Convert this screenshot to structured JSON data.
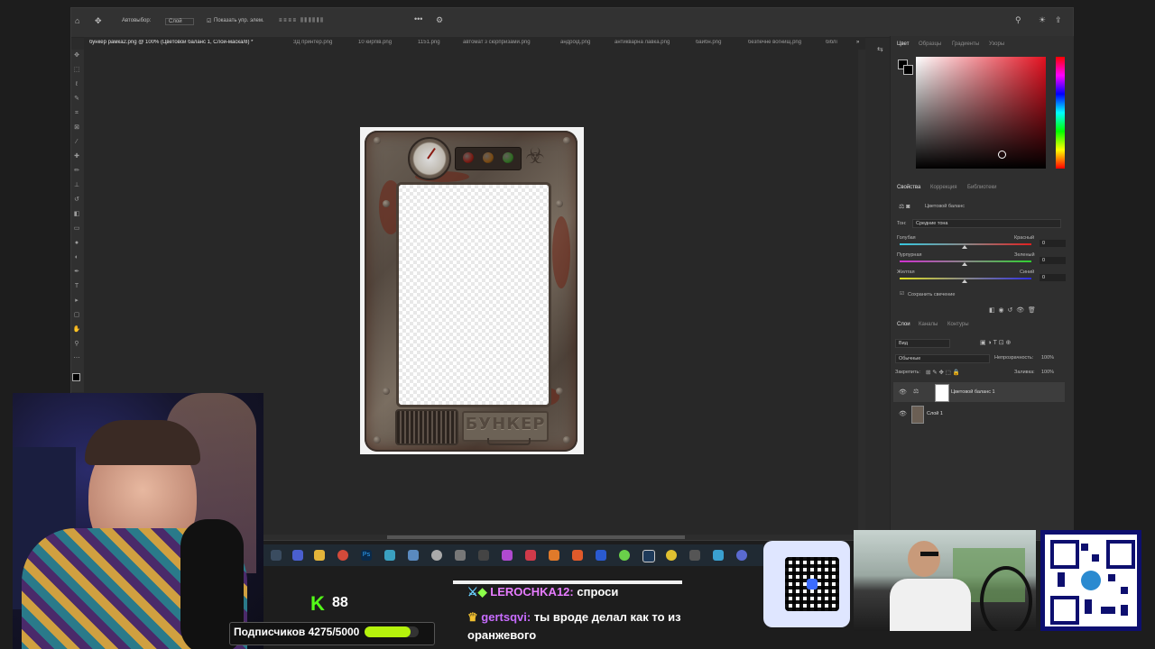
{
  "photoshop": {
    "options_bar": {
      "autoselect_label": "Автовыбор:",
      "autoselect_value": "Слой",
      "show_controls_label": "Показать упр. элем."
    },
    "tabs": [
      {
        "label": "бункер рамка2.png @ 100% (Цветовой баланс 1, Слой-маска/8) *",
        "active": true
      },
      {
        "label": "3Д принтер.png"
      },
      {
        "label": "10 кирпів.png"
      },
      {
        "label": "1151.png"
      },
      {
        "label": "автомат з сюрпризами.png"
      },
      {
        "label": "андрóід.png"
      },
      {
        "label": "антикварна лавка.png"
      },
      {
        "label": "байбн.png"
      },
      {
        "label": "безпечне вогнищ.png"
      },
      {
        "label": "біблі"
      }
    ],
    "document": {
      "plate_text": "БУНКЕР",
      "lamp_colors": [
        "#7a1a12",
        "#7a4a12",
        "#2f6b22"
      ]
    },
    "color_panel": {
      "tabs": [
        "Цвет",
        "Образцы",
        "Градиенты",
        "Узоры"
      ],
      "hue_color": "#e31120"
    },
    "properties_panel": {
      "tabs": [
        "Свойства",
        "Коррекция",
        "Библиотеки"
      ],
      "adjustment_name": "Цветовой баланс",
      "tone_label": "Тон:",
      "tone_value": "Средние тона",
      "sliders": [
        {
          "left": "Голубая",
          "right": "Красный",
          "value": "0",
          "colors": [
            "#36c8e0",
            "#e02020"
          ]
        },
        {
          "left": "Пурпурная",
          "right": "Зеленый",
          "value": "0",
          "colors": [
            "#d030d0",
            "#30d030"
          ]
        },
        {
          "left": "Желтая",
          "right": "Синий",
          "value": "0",
          "colors": [
            "#e0e020",
            "#3030e0"
          ]
        }
      ],
      "preserve_luminosity": "Сохранить свечение"
    },
    "layers_panel": {
      "tabs": [
        "Слои",
        "Каналы",
        "Контуры"
      ],
      "filter_value": "Вид",
      "blend_mode": "Обычные",
      "opacity_label": "Непрозрачность:",
      "opacity_value": "100%",
      "lock_label": "Закрепить:",
      "fill_label": "Заливка:",
      "fill_value": "100%",
      "layers": [
        {
          "name": "Цветовой баланс 1",
          "selected": true
        },
        {
          "name": "Слой 1",
          "selected": false
        }
      ]
    }
  },
  "stream": {
    "viewers": "88",
    "subscribers_label": "Подписчиков 4275/5000",
    "subscribers_progress": 0.855,
    "chat": [
      {
        "user": "LEROCHKA12:",
        "message": "спроси",
        "user_color": "#e77cff"
      },
      {
        "user": "gertsqvi:",
        "message": "ты вроде делал как то из",
        "user_color": "#c86cff"
      },
      {
        "user": "",
        "message": "оранжевого",
        "user_color": "#ffffff"
      }
    ]
  }
}
